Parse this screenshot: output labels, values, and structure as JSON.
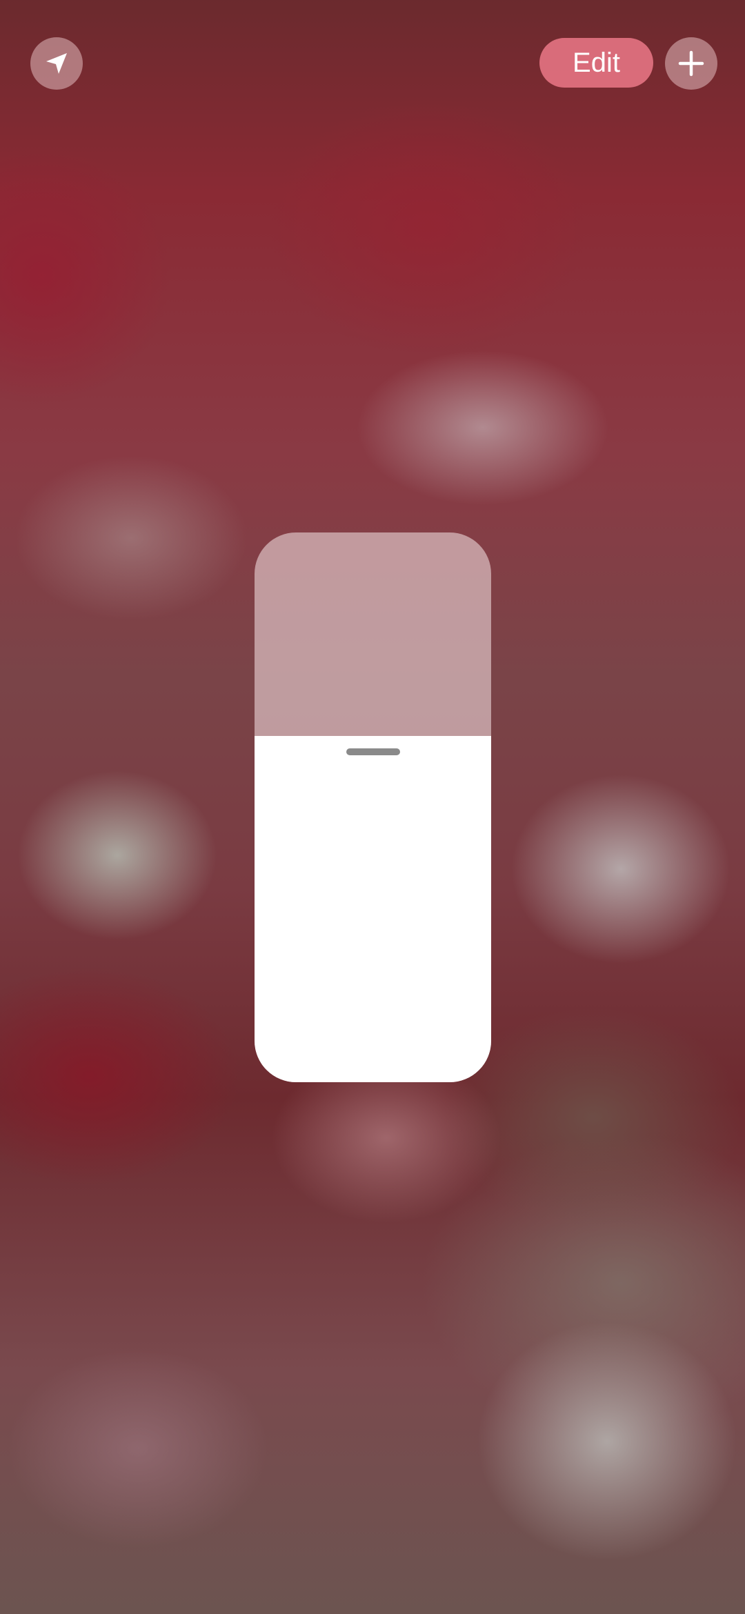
{
  "toolbar": {
    "location_icon": "location-arrow-icon",
    "edit_label": "Edit",
    "add_icon": "plus-icon"
  },
  "brightness_slider": {
    "level": 0.63,
    "grabber_visible": true
  },
  "colors": {
    "edit_button": "#e8788a",
    "slider_fill": "#ffffff",
    "slider_track": "#d7b9bc",
    "grabber": "#8a8a8a"
  }
}
